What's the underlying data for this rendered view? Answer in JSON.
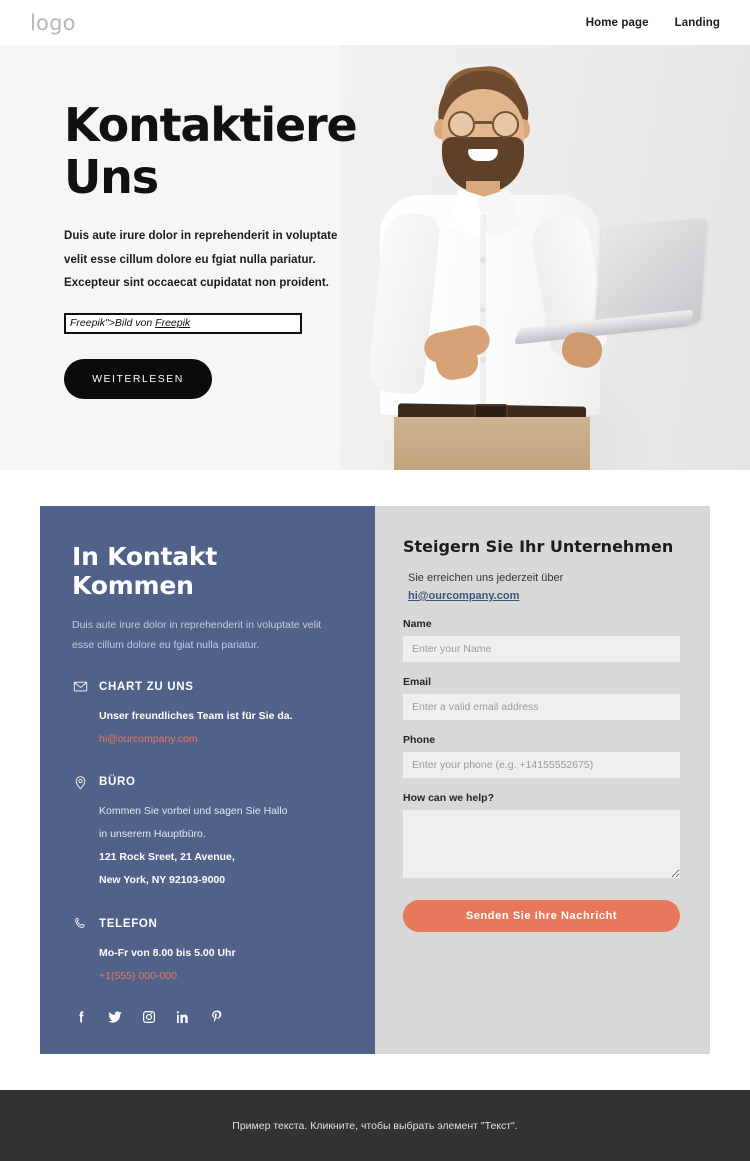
{
  "header": {
    "logo": "logo",
    "nav": [
      {
        "label": "Home page"
      },
      {
        "label": "Landing"
      }
    ]
  },
  "hero": {
    "title": "Kontaktiere Uns",
    "paragraphs": [
      "Duis aute irure dolor in reprehenderit in voluptate",
      "velit esse cillum dolore eu fgiat nulla pariatur.",
      "Excepteur sint occaecat cupidatat non proident."
    ],
    "credit_prefix": "Freepik\">Bild von ",
    "credit_link": "Freepik",
    "cta_label": "WEITERLESEN",
    "image_alt": "Man with glasses holding a laptop"
  },
  "contact": {
    "title": "In Kontakt Kommen",
    "subtitle": [
      "Duis aute irure dolor in reprehenderit in voluptate velit",
      "esse cillum dolore eu fgiat nulla pariatur."
    ],
    "items": [
      {
        "icon": "mail-icon",
        "label": "CHART ZU UNS",
        "lines": [
          "Unser freundliches Team ist für Sie da."
        ],
        "link": "hi@ourcompany.com"
      },
      {
        "icon": "location-pin-icon",
        "label": "BÜRO",
        "lines": [
          "Kommen Sie vorbei und sagen Sie Hallo",
          "in unserem Hauptbüro.",
          "121 Rock Sreet, 21 Avenue,",
          "New York, NY 92103-9000"
        ],
        "link": ""
      },
      {
        "icon": "phone-icon",
        "label": "TELEFON",
        "lines": [
          "Mo-Fr von 8.00 bis 5.00 Uhr"
        ],
        "link": "+1(555) 000-000"
      }
    ],
    "socials": [
      {
        "name": "facebook-icon"
      },
      {
        "name": "twitter-icon"
      },
      {
        "name": "instagram-icon"
      },
      {
        "name": "linkedin-icon"
      },
      {
        "name": "pinterest-icon"
      }
    ]
  },
  "form": {
    "title": "Steigern Sie Ihr Unternehmen",
    "reach_text": "Sie erreichen uns jederzeit über",
    "reach_email": "hi@ourcompany.com",
    "fields": [
      {
        "label": "Name",
        "placeholder": "Enter your Name",
        "value": "",
        "type": "text"
      },
      {
        "label": "Email",
        "placeholder": "Enter a valid email address",
        "value": "",
        "type": "text"
      },
      {
        "label": "Phone",
        "placeholder": "Enter your phone (e.g. +14155552675)",
        "value": "",
        "type": "text"
      },
      {
        "label": "How can we help?",
        "placeholder": "",
        "value": "",
        "type": "textarea"
      }
    ],
    "submit_label": "Senden Sie Ihre Nachricht"
  },
  "footer": {
    "text": "Пример текста. Кликните, чтобы выбрать элемент \"Текст\"."
  },
  "colors": {
    "panel_blue": "#51628a",
    "panel_gray": "#d8d8d8",
    "accent_orange": "#e8785c",
    "hero_bg": "#f7f6f4",
    "footer_bg": "#323232",
    "link_blue": "#3f5278"
  }
}
